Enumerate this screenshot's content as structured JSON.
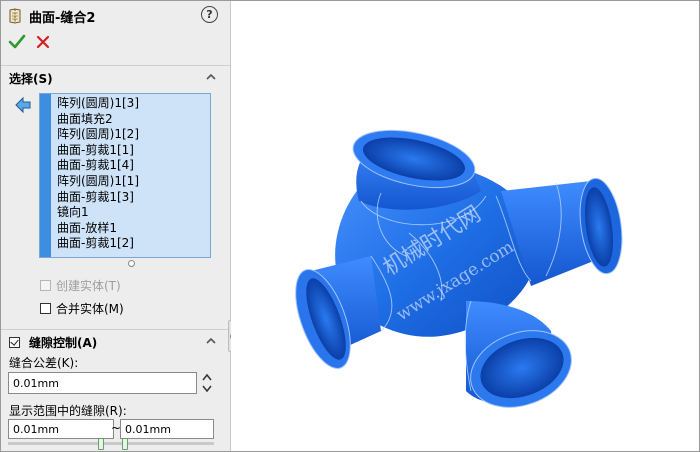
{
  "feature": {
    "title": "曲面-缝合2",
    "help_label": "?",
    "ok_icon": "checkmark-icon",
    "cancel_icon": "x-icon"
  },
  "selection": {
    "header": "选择(S)",
    "items": [
      "阵列(圆周)1[3]",
      "曲面填充2",
      "阵列(圆周)1[2]",
      "曲面-剪裁1[1]",
      "曲面-剪裁1[4]",
      "阵列(圆周)1[1]",
      "曲面-剪裁1[3]",
      "镜向1",
      "曲面-放样1",
      "曲面-剪裁1[2]"
    ],
    "create_solid": {
      "label": "创建实体(T)",
      "checked": false,
      "enabled": false
    },
    "merge_entities": {
      "label": "合并实体(M)",
      "checked": false,
      "enabled": true
    }
  },
  "gap_control": {
    "header": "缝隙控制(A)",
    "checked": true,
    "tolerance_label": "缝合公差(K):",
    "tolerance_value": "0.01mm",
    "range_label": "显示范围中的缝隙(R):",
    "range_min": "0.01mm",
    "range_separator": "~",
    "range_max": "0.01mm"
  },
  "viewport": {
    "model_color": "#1f6fe6",
    "watermark_cn": "机械时代网",
    "watermark_url": "www.jxage.com"
  },
  "colors": {
    "accent": "#3d8de0",
    "list_bg": "#cfe3f8",
    "ok_green": "#2e9a2e",
    "cancel_red": "#d42020"
  }
}
